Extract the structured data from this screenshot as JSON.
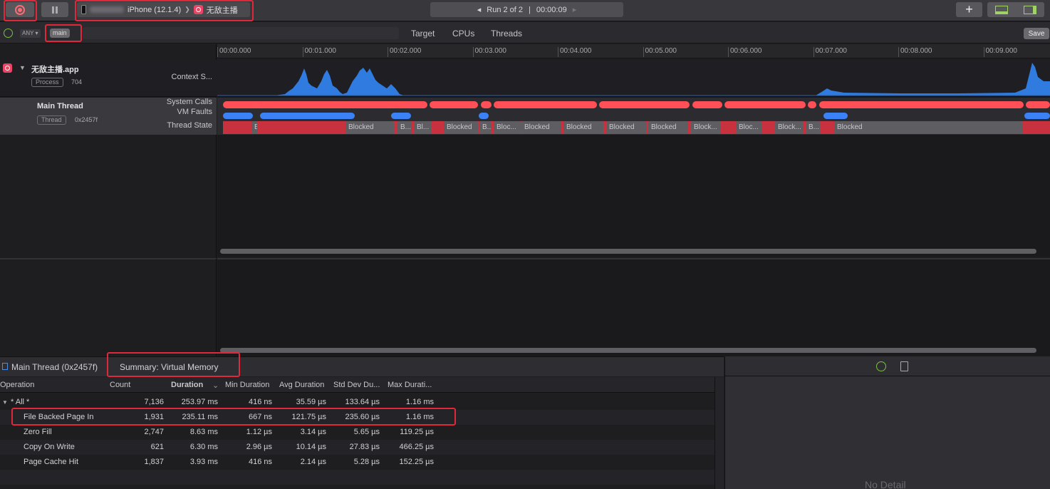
{
  "toolbar": {
    "device": "iPhone (12.1.4)",
    "separator": "❯",
    "app_name": "无敌主播",
    "run_label": "Run 2 of 2",
    "run_sep": "|",
    "elapsed": "00:00:09",
    "prev_arrow": "◂",
    "next_arrow": "▸",
    "add": "+"
  },
  "filter": {
    "scope": "ANY ▾",
    "token": "main",
    "segments": [
      "Target",
      "CPUs",
      "Threads"
    ],
    "save": "Save"
  },
  "ruler": [
    "00:00.000",
    "00:01.000",
    "00:02.000",
    "00:03.000",
    "00:04.000",
    "00:05.000",
    "00:06.000",
    "00:07.000",
    "00:08.000",
    "00:09.000"
  ],
  "tracks": {
    "process_name": "无敌主播.app",
    "process_tag": "Process",
    "process_id": "704",
    "context_label": "Context S...",
    "thread_name": "Main Thread",
    "thread_tag": "Thread",
    "thread_id": "0x2457f",
    "syscalls_label": "System Calls",
    "vmfaults_label": "VM Faults",
    "state_label": "Thread State",
    "state_segments": [
      {
        "l": 48,
        "w": 8,
        "t": "B..."
      },
      {
        "l": 180,
        "w": 68,
        "t": "Blocked"
      },
      {
        "l": 253,
        "w": 20,
        "t": "B..."
      },
      {
        "l": 276,
        "w": 25,
        "t": "Bl..."
      },
      {
        "l": 318,
        "w": 48,
        "t": "Blocked"
      },
      {
        "l": 368,
        "w": 16,
        "t": "B..."
      },
      {
        "l": 388,
        "w": 38,
        "t": "Bloc..."
      },
      {
        "l": 427,
        "w": 56,
        "t": "Blocked"
      },
      {
        "l": 486,
        "w": 56,
        "t": "Blocked"
      },
      {
        "l": 546,
        "w": 56,
        "t": "Blocked"
      },
      {
        "l": 605,
        "w": 56,
        "t": "Blocked"
      },
      {
        "l": 665,
        "w": 42,
        "t": "Block..."
      },
      {
        "l": 728,
        "w": 36,
        "t": "Bloc..."
      },
      {
        "l": 783,
        "w": 40,
        "t": "Block..."
      },
      {
        "l": 826,
        "w": 20,
        "t": "B..."
      },
      {
        "l": 866,
        "w": 265,
        "t": "Blocked"
      }
    ]
  },
  "detail": {
    "thread_crumb": "Main Thread (0x2457f)",
    "summary": "Summary: Virtual Memory",
    "columns": [
      "Operation",
      "Count",
      "Duration",
      "Min Duration",
      "Avg Duration",
      "Std Dev Du...",
      "Max Durati..."
    ],
    "sort_indicator": "⌄",
    "rows": [
      {
        "op": "* All *",
        "count": "7,136",
        "dur": "253.97 ms",
        "min": "416 ns",
        "avg": "35.59 µs",
        "std": "133.64 µs",
        "max": "1.16 ms",
        "expand": "▼"
      },
      {
        "op": "File Backed Page In",
        "count": "1,931",
        "dur": "235.11 ms",
        "min": "667 ns",
        "avg": "121.75 µs",
        "std": "235.60 µs",
        "max": "1.16 ms",
        "expand": ""
      },
      {
        "op": "Zero Fill",
        "count": "2,747",
        "dur": "8.63 ms",
        "min": "1.12 µs",
        "avg": "3.14 µs",
        "std": "5.65 µs",
        "max": "119.25 µs",
        "expand": ""
      },
      {
        "op": "Copy On Write",
        "count": "621",
        "dur": "6.30 ms",
        "min": "2.96 µs",
        "avg": "10.14 µs",
        "std": "27.83 µs",
        "max": "466.25 µs",
        "expand": ""
      },
      {
        "op": "Page Cache Hit",
        "count": "1,837",
        "dur": "3.93 ms",
        "min": "416 ns",
        "avg": "2.14 µs",
        "std": "5.28 µs",
        "max": "152.25 µs",
        "expand": ""
      }
    ],
    "no_detail": "No Detail"
  },
  "colors": {
    "accent_red": "#e0283a",
    "syscall": "#ff4f57",
    "vmfault": "#3b82f6",
    "cpu": "#2f7be0"
  }
}
